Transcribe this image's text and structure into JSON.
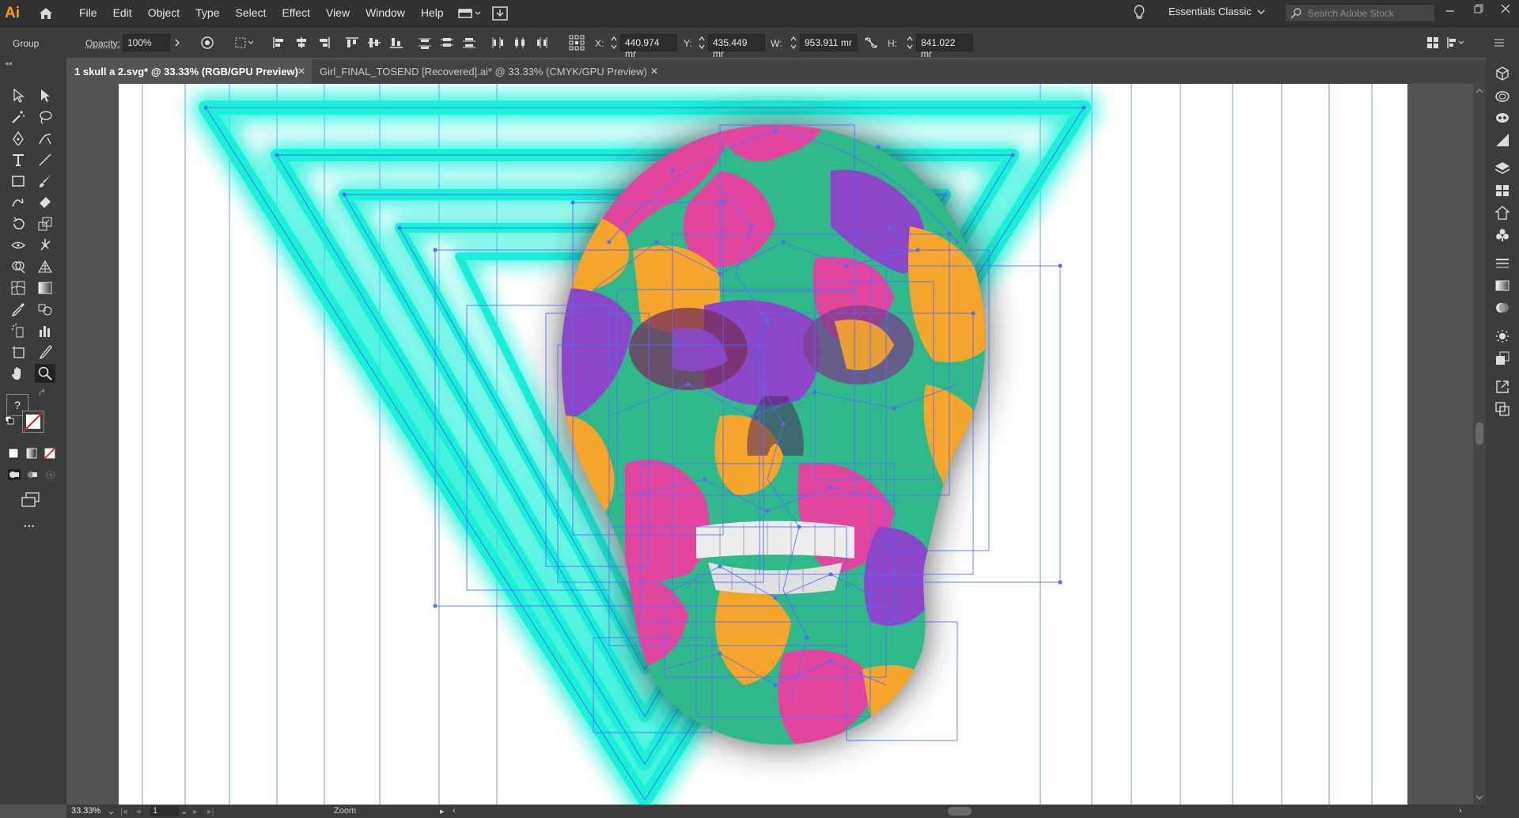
{
  "app": {
    "logo_text": "Ai",
    "menu": [
      "File",
      "Edit",
      "Object",
      "Type",
      "Select",
      "Effect",
      "View",
      "Window",
      "Help"
    ],
    "workspace": "Essentials Classic",
    "search_placeholder": "Search Adobe Stock"
  },
  "control_bar": {
    "selection_type": "Group",
    "opacity_label": "Opacity:",
    "opacity_value": "100%",
    "x_label": "X:",
    "x_value": "440.974 mr",
    "y_label": "Y:",
    "y_value": "435.449 mr",
    "w_label": "W:",
    "w_value": "953.911 mr",
    "h_label": "H:",
    "h_value": "841.022 mr"
  },
  "tabs": [
    {
      "label": "1 skull a 2.svg* @ 33.33% (RGB/GPU Preview)",
      "active": true
    },
    {
      "label": "Girl_FINAL_TOSEND [Recovered].ai* @ 33.33% (CMYK/GPU Preview)",
      "active": false
    }
  ],
  "toolbar": {
    "unknown_fill_glyph": "?",
    "more_glyph": "..."
  },
  "status": {
    "zoom": "33.33%",
    "artboard": "1",
    "tool_name": "Zoom"
  },
  "colors": {
    "neon_cyan": "#19f0d8",
    "skull_pink": "#e2459e",
    "skull_green": "#2fb98a",
    "skull_orange": "#f5a52b",
    "skull_purple": "#8c47c8",
    "selection_blue": "#4f6cff",
    "accent_orange": "#ff9a00"
  },
  "icons": {
    "tools_left": [
      "selection-tool-icon",
      "direct-selection-tool-icon",
      "magic-wand-tool-icon",
      "lasso-tool-icon",
      "pen-tool-icon",
      "curvature-tool-icon",
      "type-tool-icon",
      "line-tool-icon",
      "rectangle-tool-icon",
      "paintbrush-tool-icon",
      "shaper-tool-icon",
      "eraser-tool-icon",
      "rotate-tool-icon",
      "scale-tool-icon",
      "width-tool-icon",
      "puppet-warp-tool-icon",
      "shape-builder-tool-icon",
      "perspective-grid-tool-icon",
      "mesh-tool-icon",
      "gradient-tool-icon",
      "eyedropper-tool-icon",
      "blend-tool-icon",
      "symbol-sprayer-tool-icon",
      "column-graph-tool-icon",
      "artboard-tool-icon",
      "slice-tool-icon",
      "hand-tool-icon",
      "zoom-tool-icon"
    ]
  }
}
